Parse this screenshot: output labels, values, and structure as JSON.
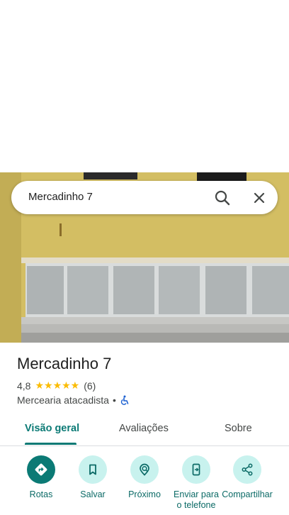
{
  "search": {
    "query": "Mercadinho 7"
  },
  "place": {
    "name": "Mercadinho 7",
    "rating": "4,8",
    "stars": "★★★★★",
    "review_count": "(6)",
    "category": "Mercearia atacadista",
    "separator": "•"
  },
  "tabs": [
    {
      "label": "Visão geral",
      "active": true
    },
    {
      "label": "Avaliações",
      "active": false
    },
    {
      "label": "Sobre",
      "active": false
    }
  ],
  "actions": [
    {
      "label": "Rotas",
      "icon": "directions-icon"
    },
    {
      "label": "Salvar",
      "icon": "bookmark-icon"
    },
    {
      "label": "Próximo",
      "icon": "nearby-icon"
    },
    {
      "label": "Enviar para o telefone",
      "icon": "send-to-phone-icon"
    },
    {
      "label": "Compartilhar",
      "icon": "share-icon"
    }
  ],
  "colors": {
    "accent": "#0b7a75",
    "accent_light": "#c8f2ee",
    "star": "#fbbc04",
    "wall": "#d8c46a"
  }
}
